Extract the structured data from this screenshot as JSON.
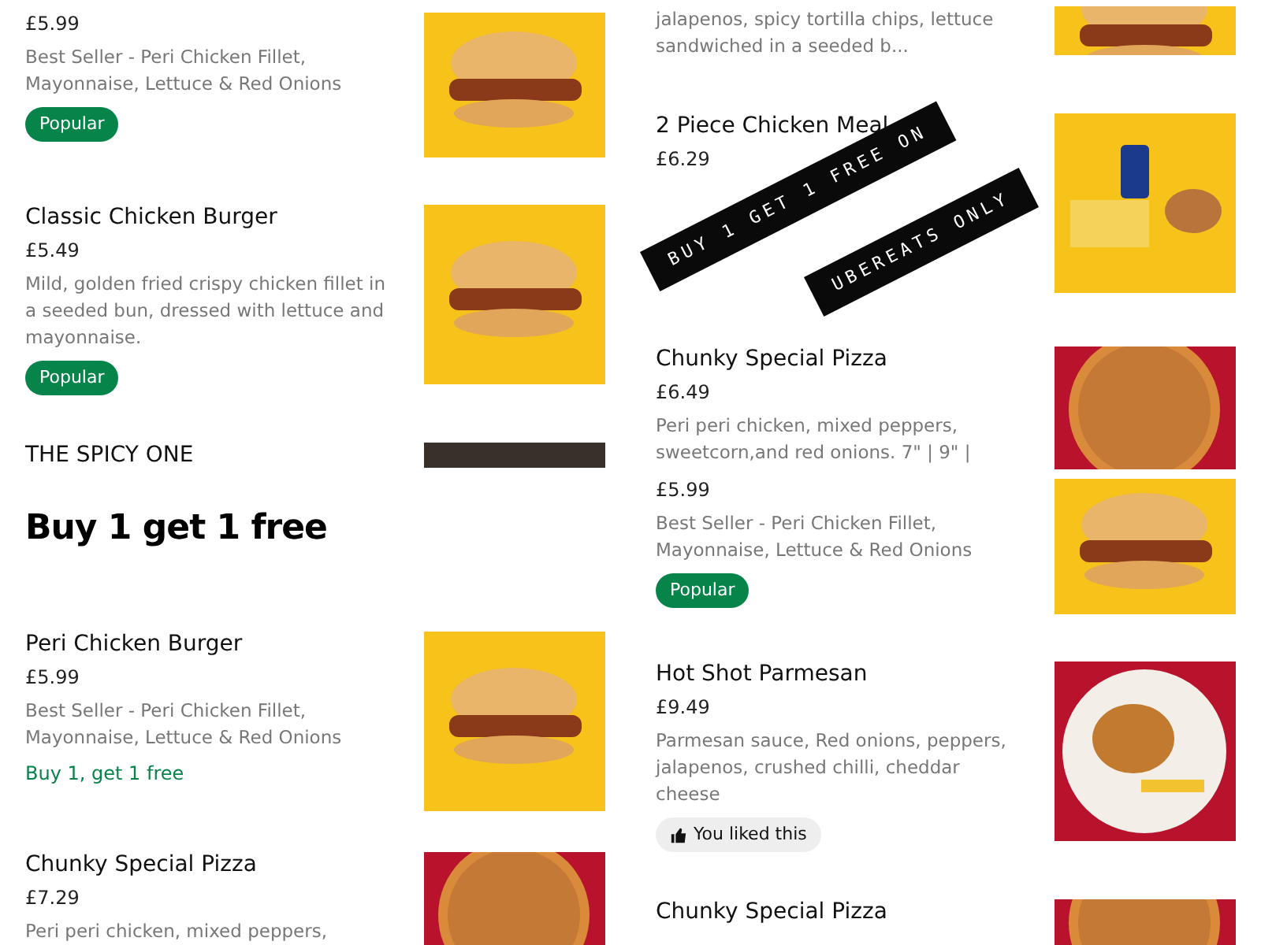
{
  "panels": [
    {
      "items": [
        {
          "price": "£5.99",
          "description": "Best Seller - Peri Chicken Fillet, Mayonnaise, Lettuce & Red Onions",
          "badge": {
            "kind": "popular",
            "text": "Popular"
          },
          "photo": {
            "kind": "burger"
          }
        },
        {
          "name": "Classic Chicken Burger",
          "price": "£5.49",
          "description": "Mild, golden fried crispy chicken fillet in a seeded bun, dressed with lettuce and mayonnaise.",
          "badge": {
            "kind": "popular",
            "text": "Popular"
          },
          "photo": {
            "kind": "burger"
          }
        },
        {
          "name": "THE SPICY ONE",
          "photo": {
            "kind": "dark"
          }
        }
      ]
    },
    {
      "items": [
        {
          "description": "jalapenos, spicy tortilla chips, lettuce sandwiched in a seeded b...",
          "photo": {
            "kind": "burger"
          }
        },
        {
          "name": "2 Piece Chicken Meal",
          "price": "£6.29",
          "photo": {
            "kind": "meal"
          }
        },
        {
          "name": "Chunky Special Pizza",
          "price": "£6.49",
          "description": "Peri peri chicken, mixed peppers, sweetcorn,and red onions. 7\" | 9\" |",
          "photo": {
            "kind": "pizza"
          }
        }
      ],
      "stamp": [
        "BUY 1 GET 1 FREE ON",
        "UBEREATS ONLY"
      ]
    },
    {
      "heading": "Buy 1 get 1 free",
      "items": [
        {
          "name": "Peri Chicken Burger",
          "price": "£5.99",
          "description": "Best Seller - Peri Chicken Fillet, Mayonnaise, Lettuce & Red Onions",
          "badge": {
            "kind": "offer",
            "text": "Buy 1, get 1 free"
          },
          "photo": {
            "kind": "burger"
          }
        },
        {
          "name": "Chunky Special Pizza",
          "price": "£7.29",
          "description": "Peri peri chicken, mixed peppers,",
          "photo": {
            "kind": "pizza"
          }
        }
      ]
    },
    {
      "items": [
        {
          "price": "£5.99",
          "description": "Best Seller - Peri Chicken Fillet, Mayonnaise, Lettuce & Red Onions",
          "badge": {
            "kind": "popular",
            "text": "Popular"
          },
          "photo": {
            "kind": "burger"
          }
        },
        {
          "name": "Hot Shot Parmesan",
          "price": "£9.49",
          "description": "Parmesan sauce, Red onions, peppers, jalapenos, crushed chilli, cheddar cheese",
          "badge": {
            "kind": "liked",
            "text": "You liked this"
          },
          "photo": {
            "kind": "plate"
          }
        },
        {
          "name": "Chunky Special Pizza",
          "photo": {
            "kind": "pizza"
          }
        }
      ]
    }
  ]
}
